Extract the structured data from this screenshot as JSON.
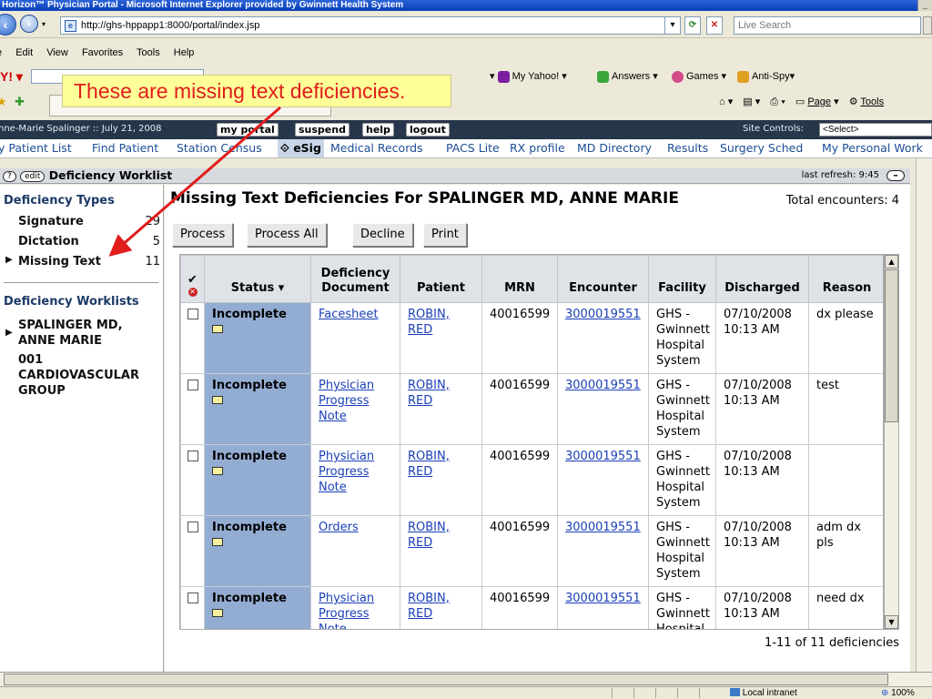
{
  "window": {
    "title": "Horizon™ Physician Portal - Microsoft Internet Explorer provided by Gwinnett Health System"
  },
  "browser": {
    "address": "http://ghs-hppapp1:8000/portal/index.jsp",
    "search_placeholder": "Live Search",
    "menu": [
      "e",
      "Edit",
      "View",
      "Favorites",
      "Tools",
      "Help"
    ],
    "toolbar": {
      "yahoo": "My Yahoo!",
      "answers": "Answers",
      "games": "Games",
      "antispy": "Anti-Spy"
    },
    "tab_cmds": {
      "page": "Page",
      "tools": "Tools"
    }
  },
  "annotation": {
    "text": "These are missing text deficiencies."
  },
  "portal": {
    "user": "nne-Marie Spalinger :: July 21, 2008",
    "buttons": [
      "my portal",
      "suspend",
      "help",
      "logout"
    ],
    "site_controls_label": "Site Controls:",
    "site_controls_value": "<Select>"
  },
  "nav": {
    "items": [
      "y Patient List",
      "Find Patient",
      "Station Census",
      "eSig",
      "Medical Records",
      "PACS Lite",
      "RX profile",
      "MD Directory",
      "Results",
      "Surgery Sched",
      "My Personal Work"
    ],
    "active": "eSig"
  },
  "worklist": {
    "help": "?",
    "edit": "edit",
    "title": "Deficiency Worklist",
    "last_refresh": "last refresh: 9:45"
  },
  "sidebar": {
    "types_header": "Deficiency Types",
    "types": [
      {
        "label": "Signature",
        "count": "29"
      },
      {
        "label": "Dictation",
        "count": "5"
      },
      {
        "label": "Missing Text",
        "count": "11"
      }
    ],
    "worklists_header": "Deficiency Worklists",
    "worklists": [
      "SPALINGER MD, ANNE MARIE",
      "001 CARDIOVASCULAR GROUP"
    ]
  },
  "main": {
    "title": "Missing Text Deficiencies For SPALINGER MD, ANNE MARIE",
    "total": "Total encounters: 4",
    "buttons": [
      "Process",
      "Process All",
      "Decline",
      "Print"
    ],
    "columns": [
      "Status ▾",
      "Deficiency Document",
      "Patient",
      "MRN",
      "Encounter",
      "Facility",
      "Discharged",
      "Reason"
    ],
    "rows": [
      {
        "status": "Incomplete",
        "document": "Facesheet",
        "patient": "ROBIN, RED",
        "mrn": "40016599",
        "encounter": "3000019551",
        "facility": "GHS - Gwinnett Hospital System",
        "discharged": "07/10/2008 10:13 AM",
        "reason": "dx please"
      },
      {
        "status": "Incomplete",
        "document": "Physician Progress Note",
        "patient": "ROBIN, RED",
        "mrn": "40016599",
        "encounter": "3000019551",
        "facility": "GHS - Gwinnett Hospital System",
        "discharged": "07/10/2008 10:13 AM",
        "reason": "test"
      },
      {
        "status": "Incomplete",
        "document": "Physician Progress Note",
        "patient": "ROBIN, RED",
        "mrn": "40016599",
        "encounter": "3000019551",
        "facility": "GHS - Gwinnett Hospital System",
        "discharged": "07/10/2008 10:13 AM",
        "reason": ""
      },
      {
        "status": "Incomplete",
        "document": "Orders",
        "patient": "ROBIN, RED",
        "mrn": "40016599",
        "encounter": "3000019551",
        "facility": "GHS - Gwinnett Hospital System",
        "discharged": "07/10/2008 10:13 AM",
        "reason": "adm dx pls"
      },
      {
        "status": "Incomplete",
        "document": "Physician Progress Note",
        "patient": "ROBIN, RED",
        "mrn": "40016599",
        "encounter": "3000019551",
        "facility": "GHS - Gwinnett Hospital",
        "discharged": "07/10/2008 10:13 AM",
        "reason": "need dx"
      }
    ],
    "pager": "1-11 of 11 deficiencies"
  },
  "statusbar": {
    "zone": "Local intranet",
    "zoom": "100%"
  },
  "colors": {
    "status_cell": "#93acd2",
    "link": "#1a3fb8",
    "annotation_text": "#e11d1d",
    "annotation_bg": "#ffff99",
    "portal_bar": "#26364b"
  }
}
